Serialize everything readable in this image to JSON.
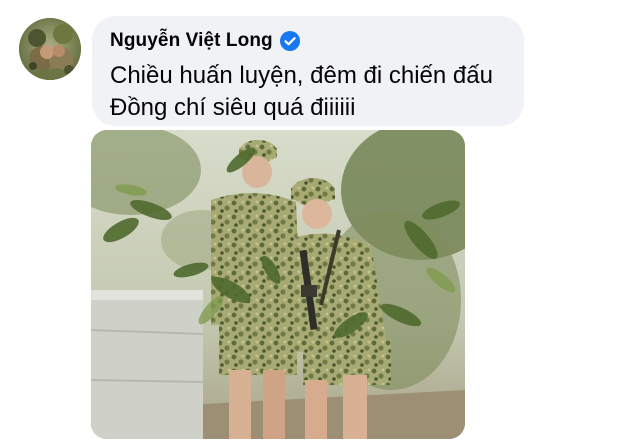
{
  "comment": {
    "author": "Nguyễn Việt Long",
    "verified_icon": "verified-check-icon",
    "lines": [
      "Chiều huấn luyện, đêm đi chiến đấu",
      "Đồng chí siêu quá điiiiii"
    ]
  },
  "avatar": {
    "icon": "profile-photo"
  },
  "attachment": {
    "type": "photo"
  },
  "colors": {
    "bubble": "#f0f2f5",
    "verified": "#1877f2",
    "text": "#050505",
    "camo": "#8a8a55"
  }
}
